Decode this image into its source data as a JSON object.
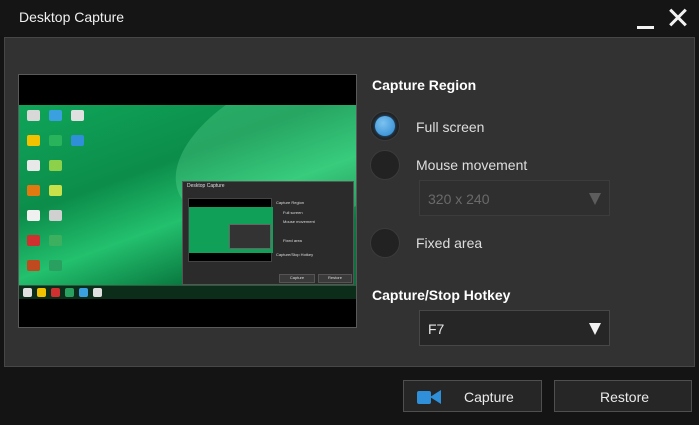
{
  "window": {
    "title": "Desktop Capture"
  },
  "preview": {},
  "capture_region": {
    "heading": "Capture Region",
    "options": [
      {
        "label": "Full screen",
        "checked": true
      },
      {
        "label": "Mouse movement",
        "checked": false
      },
      {
        "label": "Fixed area",
        "checked": false
      }
    ],
    "mouse_size": {
      "value": "320 x 240",
      "enabled": false
    }
  },
  "hotkey": {
    "heading": "Capture/Stop Hotkey",
    "value": "F7"
  },
  "buttons": {
    "capture_label": "Capture",
    "restore_label": "Restore"
  },
  "colors": {
    "accent": "#2f8fd8",
    "panel": "#323232",
    "window": "#141414"
  },
  "icons": {
    "minimize": "minimize-icon",
    "close": "close-icon",
    "capture": "video-camera-icon"
  }
}
